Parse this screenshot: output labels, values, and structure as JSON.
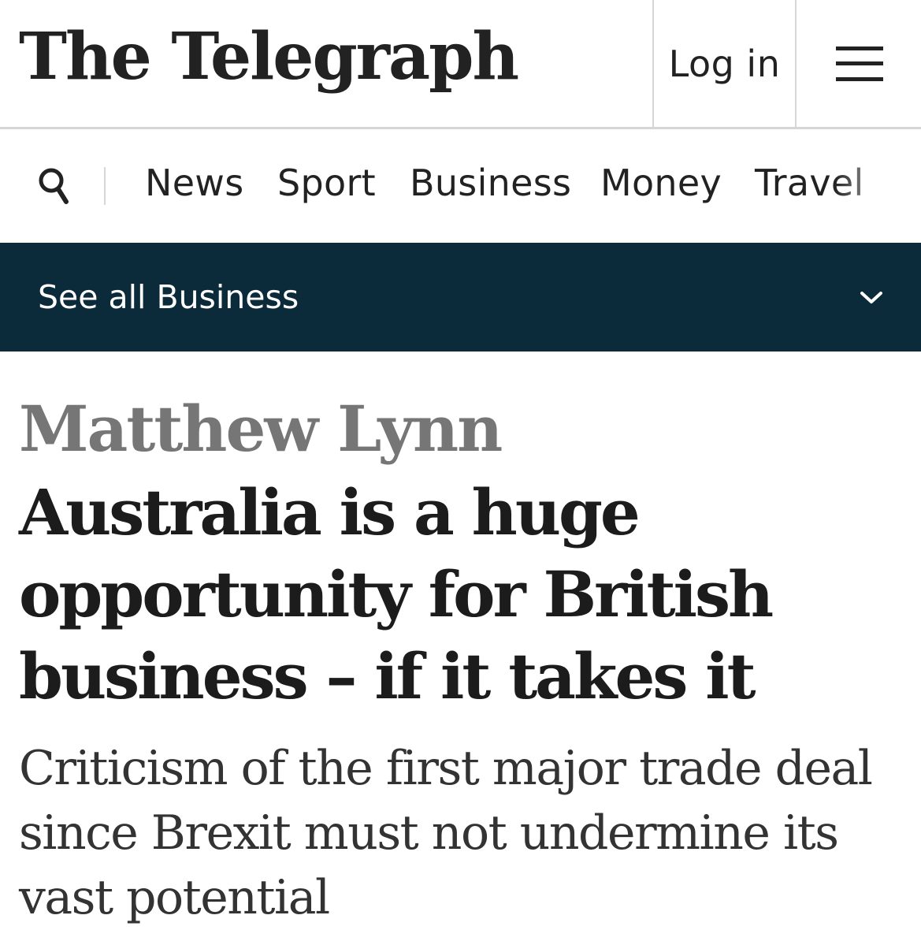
{
  "masthead": {
    "logo_text": "The Telegraph",
    "login_label": "Log in",
    "menu_icon": "hamburger-menu-icon"
  },
  "nav": {
    "search_icon": "search-icon",
    "items": [
      {
        "label": "News"
      },
      {
        "label": "Sport"
      },
      {
        "label": "Business"
      },
      {
        "label": "Money"
      },
      {
        "label": "Travel"
      }
    ]
  },
  "section": {
    "label": "See all Business",
    "chevron_icon": "chevron-down-icon"
  },
  "article": {
    "author": "Matthew Lynn",
    "headline": "Australia is a huge opportunity for British business – if it takes it",
    "standfirst": "Criticism of the first major trade deal since Brexit must not undermine its vast potential"
  },
  "colors": {
    "section_bar": "#0b2a3a",
    "author": "#767676",
    "headline": "#1c1c1c",
    "divider": "#d6d6d6"
  }
}
